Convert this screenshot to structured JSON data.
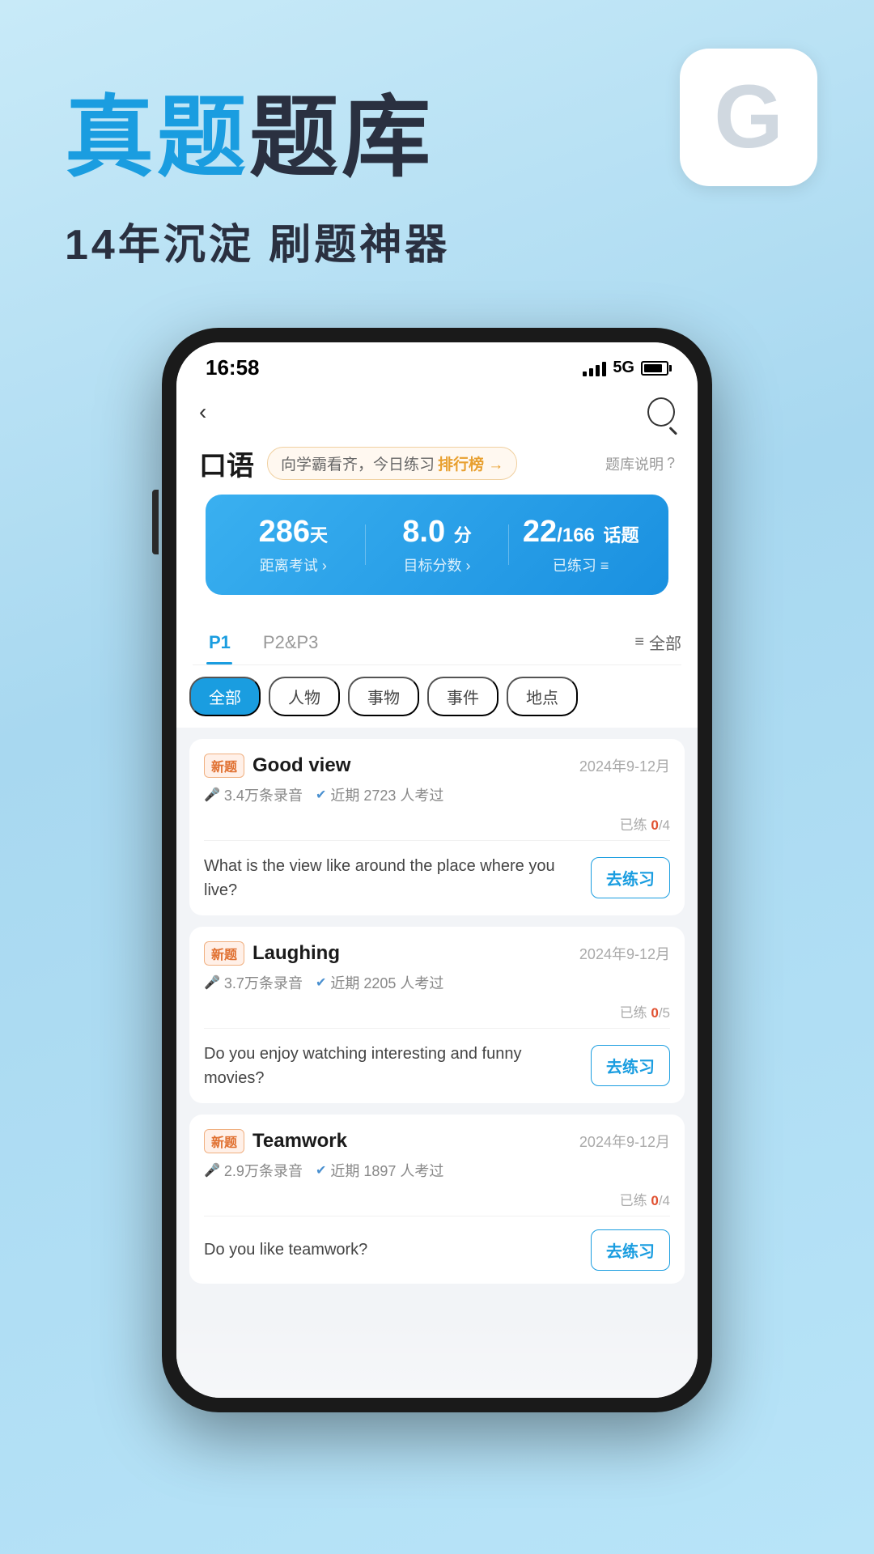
{
  "app": {
    "background_top": "#c8eaf8",
    "background_bottom": "#a8d8f0"
  },
  "header": {
    "title_blue": "真题",
    "title_dark": "题库",
    "subtitle": "14年沉淀 刷题神器",
    "logo_char": ""
  },
  "phone": {
    "status_bar": {
      "time": "16:58",
      "signal": "5G"
    },
    "nav": {
      "back_icon": "‹",
      "search_icon": "🔍"
    },
    "page": {
      "title": "口语",
      "banner_text": "向学霸看齐，今日练习",
      "ranking_link": "排行榜 →",
      "help_text": "题库说明",
      "help_icon": "?"
    },
    "stats": {
      "days": {
        "number": "286",
        "unit": "天",
        "label": "距离考试 ›"
      },
      "score": {
        "number": "8.0",
        "unit": "分",
        "label": "目标分数 ›"
      },
      "topics": {
        "current": "22",
        "total": "166",
        "unit": "话题",
        "label": "已练习 ≡"
      }
    },
    "tabs": {
      "items": [
        {
          "id": "p1",
          "label": "P1",
          "active": true
        },
        {
          "id": "p2p3",
          "label": "P2&P3",
          "active": false
        }
      ],
      "filter_label": "全部"
    },
    "categories": [
      {
        "id": "all",
        "label": "全部",
        "active": true
      },
      {
        "id": "people",
        "label": "人物",
        "active": false
      },
      {
        "id": "things",
        "label": "事物",
        "active": false
      },
      {
        "id": "events",
        "label": "事件",
        "active": false
      },
      {
        "id": "places",
        "label": "地点",
        "active": false
      }
    ],
    "topics": [
      {
        "id": "good-view",
        "badge": "新题",
        "title": "Good view",
        "date": "2024年9-12月",
        "recordings": "3.4万条录音",
        "recent_count": "近期 2723 人考过",
        "progress_done": "0",
        "progress_total": "4",
        "progress_label": "已练 0/4",
        "question": "What is the view like around the place where you live?",
        "practice_btn": "去练习"
      },
      {
        "id": "laughing",
        "badge": "新题",
        "title": "Laughing",
        "date": "2024年9-12月",
        "recordings": "3.7万条录音",
        "recent_count": "近期 2205 人考过",
        "progress_done": "0",
        "progress_total": "5",
        "progress_label": "已练 0/5",
        "question": "Do you enjoy watching interesting and funny movies?",
        "practice_btn": "去练习"
      },
      {
        "id": "teamwork",
        "badge": "新题",
        "title": "Teamwork",
        "date": "2024年9-12月",
        "recordings": "2.9万条录音",
        "recent_count": "近期 1897 人考过",
        "progress_done": "0",
        "progress_total": "4",
        "progress_label": "已练 0/4",
        "question": "Do you like teamwork?",
        "practice_btn": "去练习"
      }
    ]
  }
}
